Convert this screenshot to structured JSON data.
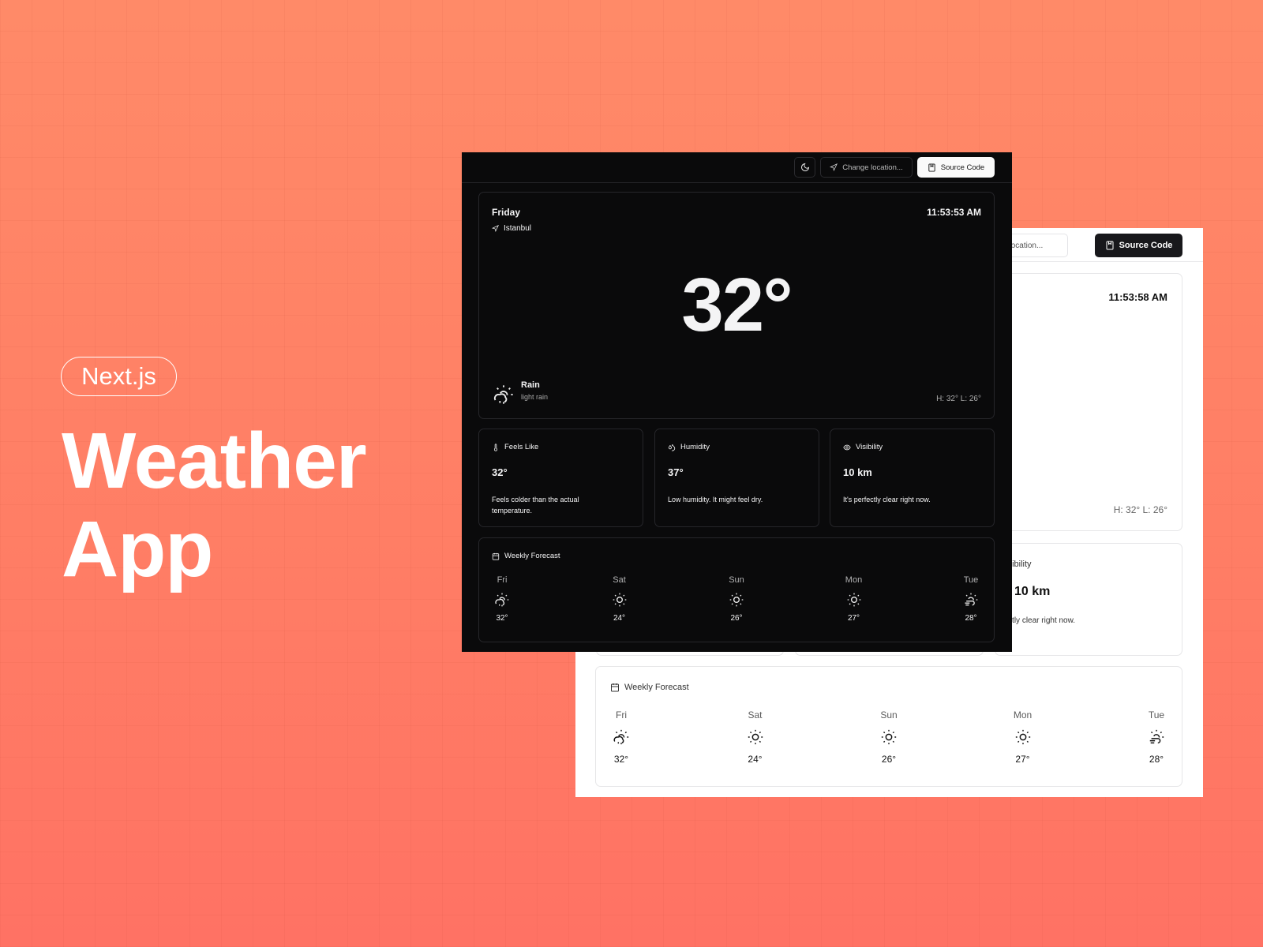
{
  "hero": {
    "badge": "Next.js",
    "title_line1": "Weather",
    "title_line2": "App"
  },
  "dark": {
    "header": {
      "theme_icon": "moon-icon",
      "change_location": "Change location...",
      "source_code": "Source Code"
    },
    "current": {
      "day": "Friday",
      "location": "Istanbul",
      "time": "11:53:53 AM",
      "temp": "32°",
      "condition": "Rain",
      "description": "light rain",
      "high_low": "H: 32°  L: 26°"
    },
    "metrics": [
      {
        "label": "Feels Like",
        "icon": "thermometer-icon",
        "value": "32°",
        "note": "Feels colder than the actual temperature."
      },
      {
        "label": "Humidity",
        "icon": "droplets-icon",
        "value": "37°",
        "note": "Low humidity. It might feel dry."
      },
      {
        "label": "Visibility",
        "icon": "eye-icon",
        "value": "10 km",
        "note": "It's perfectly clear right now."
      }
    ],
    "forecast": {
      "title": "Weekly Forecast",
      "days": [
        {
          "day": "Fri",
          "temp": "32°",
          "icon": "cloud-sun-rain-icon"
        },
        {
          "day": "Sat",
          "temp": "24°",
          "icon": "sun-icon"
        },
        {
          "day": "Sun",
          "temp": "26°",
          "icon": "sun-icon"
        },
        {
          "day": "Mon",
          "temp": "27°",
          "icon": "sun-icon"
        },
        {
          "day": "Tue",
          "temp": "28°",
          "icon": "cloud-sun-wind-icon"
        }
      ]
    }
  },
  "light": {
    "header": {
      "change_location": "Change location...",
      "source_code": "Source Code"
    },
    "current": {
      "time": "11:53:58 AM",
      "high_low": "H: 32°  L: 26°"
    },
    "visibility": {
      "label": "Visibility",
      "value": "10 km",
      "note": "It's perfectly clear right now."
    },
    "forecast": {
      "title": "Weekly Forecast",
      "days": [
        {
          "day": "Fri",
          "temp": "32°"
        },
        {
          "day": "Sat",
          "temp": "24°"
        },
        {
          "day": "Sun",
          "temp": "26°"
        },
        {
          "day": "Mon",
          "temp": "27°"
        },
        {
          "day": "Tue",
          "temp": "28°"
        }
      ]
    }
  },
  "colors": {
    "background": "#ff7f65",
    "dark_panel": "#0a0a0b",
    "light_panel": "#ffffff"
  }
}
